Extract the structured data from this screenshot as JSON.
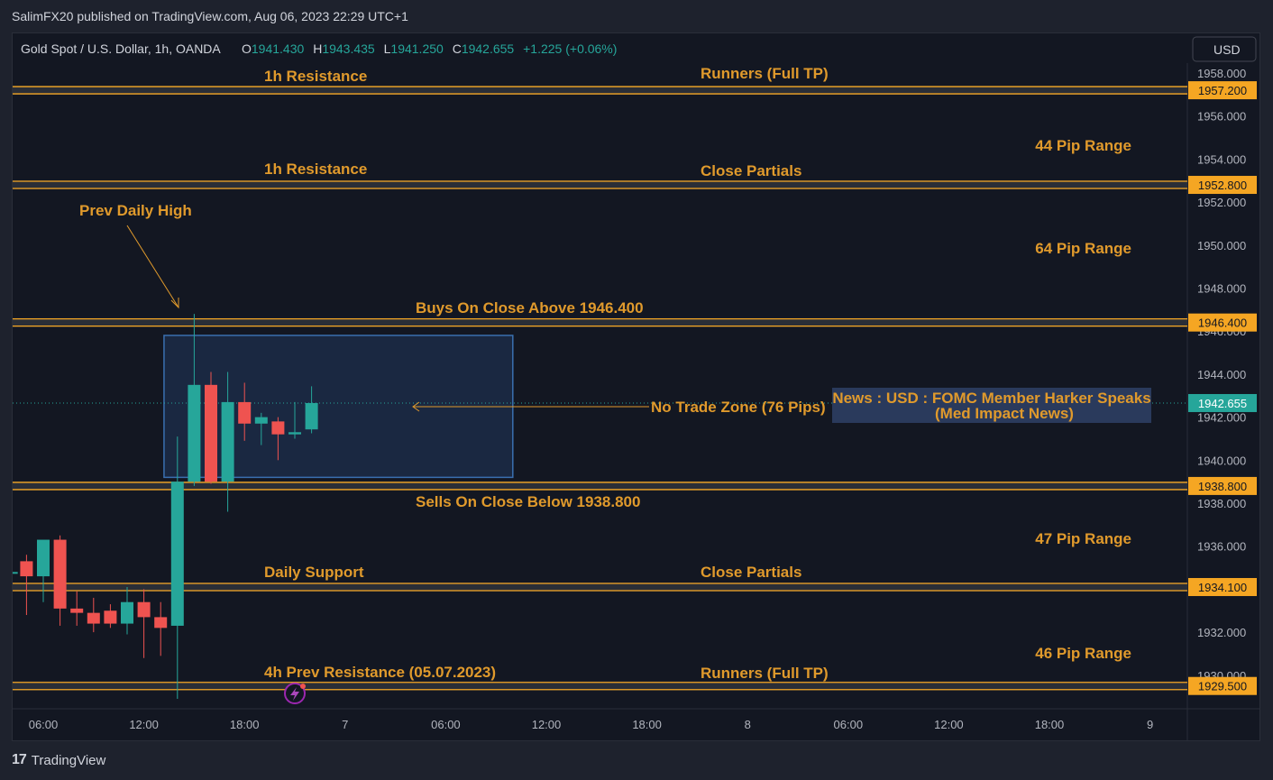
{
  "publisher": {
    "text": "SalimFX20 published on TradingView.com, Aug 06, 2023 22:29 UTC+1"
  },
  "legend": {
    "symbol": "Gold Spot / U.S. Dollar, 1h, OANDA",
    "o_label": "O",
    "o_value": "1941.430",
    "h_label": "H",
    "h_value": "1943.435",
    "l_label": "L",
    "l_value": "1941.250",
    "c_label": "C",
    "c_value": "1942.655",
    "change": "+1.225 (+0.06%)"
  },
  "currency_button": "USD",
  "brand": {
    "logo": "17",
    "name": "TradingView"
  },
  "colors": {
    "background": "#131722",
    "frame": "#1e222d",
    "bull": "#26a69a",
    "bear": "#ef5350",
    "level": "#f5a623",
    "annotation": "#e09a2c",
    "zone_border": "#3a6fb0",
    "zone_fill": "#1c2a45"
  },
  "chart_data": {
    "type": "candlestick",
    "title": "Gold Spot / U.S. Dollar, 1h, OANDA",
    "ylim": [
      1929.0,
      1958.4
    ],
    "price_ticks": [
      "1958.000",
      "1956.000",
      "1954.000",
      "1952.000",
      "1950.000",
      "1948.000",
      "1946.000",
      "1944.000",
      "1942.000",
      "1940.000",
      "1938.000",
      "1936.000",
      "1934.000",
      "1932.000",
      "1930.000"
    ],
    "time_ticks": [
      "06:00",
      "12:00",
      "18:00",
      "7",
      "06:00",
      "12:00",
      "18:00",
      "8",
      "06:00",
      "12:00",
      "18:00",
      "9"
    ],
    "time_tick_bars": [
      6,
      12,
      18,
      24,
      30,
      36,
      42,
      48,
      54,
      60,
      66,
      72
    ],
    "candles": [
      {
        "bar": 4.1,
        "o": 1934.8,
        "h": 1935.4,
        "l": 1933.2,
        "c": 1934.8
      },
      {
        "bar": 5.0,
        "o": 1935.3,
        "h": 1935.6,
        "l": 1932.8,
        "c": 1934.6
      },
      {
        "bar": 6.0,
        "o": 1934.6,
        "h": 1936.2,
        "l": 1933.4,
        "c": 1936.3
      },
      {
        "bar": 7.0,
        "o": 1936.3,
        "h": 1936.5,
        "l": 1932.3,
        "c": 1933.1
      },
      {
        "bar": 8.0,
        "o": 1933.1,
        "h": 1933.9,
        "l": 1932.3,
        "c": 1932.9
      },
      {
        "bar": 9.0,
        "o": 1932.9,
        "h": 1933.6,
        "l": 1932.0,
        "c": 1932.4
      },
      {
        "bar": 10.0,
        "o": 1933.0,
        "h": 1933.3,
        "l": 1932.2,
        "c": 1932.4
      },
      {
        "bar": 11.0,
        "o": 1932.4,
        "h": 1934.1,
        "l": 1931.9,
        "c": 1933.4
      },
      {
        "bar": 12.0,
        "o": 1933.4,
        "h": 1934.0,
        "l": 1930.8,
        "c": 1932.7
      },
      {
        "bar": 13.0,
        "o": 1932.7,
        "h": 1933.4,
        "l": 1930.9,
        "c": 1932.2
      },
      {
        "bar": 14.0,
        "o": 1932.3,
        "h": 1941.1,
        "l": 1928.9,
        "c": 1939.0
      },
      {
        "bar": 15.0,
        "o": 1939.0,
        "h": 1946.8,
        "l": 1938.8,
        "c": 1943.5
      },
      {
        "bar": 16.0,
        "o": 1943.5,
        "h": 1944.1,
        "l": 1938.9,
        "c": 1939.0
      },
      {
        "bar": 17.0,
        "o": 1939.0,
        "h": 1944.1,
        "l": 1937.6,
        "c": 1942.7
      },
      {
        "bar": 18.0,
        "o": 1942.7,
        "h": 1943.6,
        "l": 1940.9,
        "c": 1941.7
      },
      {
        "bar": 19.0,
        "o": 1941.7,
        "h": 1942.2,
        "l": 1940.7,
        "c": 1942.0
      },
      {
        "bar": 20.0,
        "o": 1941.8,
        "h": 1942.0,
        "l": 1940.0,
        "c": 1941.2
      },
      {
        "bar": 21.0,
        "o": 1941.2,
        "h": 1942.7,
        "l": 1941.0,
        "c": 1941.3
      },
      {
        "bar": 22.0,
        "o": 1941.43,
        "h": 1943.435,
        "l": 1941.25,
        "c": 1942.655
      }
    ],
    "levels": [
      {
        "price": 1957.2,
        "label": "1957.200"
      },
      {
        "price": 1952.8,
        "label": "1952.800"
      },
      {
        "price": 1946.4,
        "label": "1946.400"
      },
      {
        "price": 1938.8,
        "label": "1938.800"
      },
      {
        "price": 1934.1,
        "label": "1934.100"
      },
      {
        "price": 1929.5,
        "label": "1929.500"
      }
    ],
    "current_price": {
      "price": 1942.655,
      "label": "1942.655"
    },
    "zone": {
      "bar_start": 13.2,
      "bar_end": 34.0,
      "price_top": 1945.8,
      "price_bottom": 1939.2
    },
    "annotations": {
      "res1_left": "1h Resistance",
      "res1_right": "Runners (Full TP)",
      "res2_left": "1h Resistance",
      "res2_right": "Close Partials",
      "range1": "44 Pip Range",
      "range2": "64 Pip Range",
      "prev_high": "Prev Daily High",
      "buys": "Buys On Close Above 1946.400",
      "no_trade": "No Trade Zone (76 Pips)",
      "news_line1": "News : USD : FOMC Member Harker Speaks",
      "news_line2": "(Med Impact News)",
      "sells": "Sells On Close Below 1938.800",
      "range3": "47 Pip Range",
      "support_left": "Daily Support",
      "support_right": "Close Partials",
      "range4": "46 Pip Range",
      "prev_res_left": "4h Prev Resistance (05.07.2023)",
      "prev_res_right": "Runners (Full TP)"
    }
  }
}
